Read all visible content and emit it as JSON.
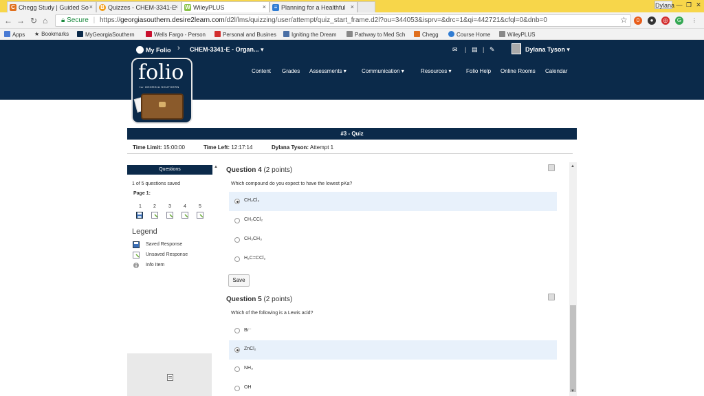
{
  "browser": {
    "tabs": [
      {
        "title": "Chegg Study | Guided So",
        "icon": "chegg-icon",
        "color": "#e0701e",
        "glyph": "C"
      },
      {
        "title": "Quizzes - CHEM-3341-E",
        "icon": "d2l-icon",
        "color": "#f39c12",
        "glyph": "B"
      },
      {
        "title": "WileyPLUS",
        "icon": "wileyplus-icon",
        "color": "#8bc34a",
        "glyph": "W"
      },
      {
        "title": "Planning for a Healthful",
        "icon": "document-icon",
        "color": "#2f7cd3",
        "glyph": "≡"
      }
    ],
    "window_user": "Dylana",
    "url_secure": "Secure",
    "url_scheme": "https://",
    "url_host": "georgiasouthern.desire2learn.com",
    "url_path": "/d2l/lms/quizzing/user/attempt/quiz_start_frame.d2l?ou=344053&isprv=&drc=1&qi=442721&cfql=0&dnb=0"
  },
  "bookmarks": [
    {
      "label": "Apps",
      "icon": "apps-icon",
      "color": "#4a7bd4"
    },
    {
      "label": "Bookmarks",
      "icon": "star-icon",
      "color": "#555555"
    },
    {
      "label": "MyGeorgiaSouthern",
      "icon": "georgia-southern-icon",
      "color": "#0b2a4a"
    },
    {
      "label": "Wells Fargo - Person",
      "icon": "wells-fargo-icon",
      "color": "#c8102e"
    },
    {
      "label": "Personal and Busines",
      "icon": "s-icon",
      "color": "#d32f2f"
    },
    {
      "label": "Igniting the Dream",
      "icon": "page-icon",
      "color": "#4a6fa5"
    },
    {
      "label": "Pathway to Med Sch",
      "icon": "page-icon",
      "color": "#888888"
    },
    {
      "label": "Chegg",
      "icon": "chegg-icon",
      "color": "#e0701e"
    },
    {
      "label": "Course Home",
      "icon": "p-icon",
      "color": "#2f7cd3"
    },
    {
      "label": "WileyPLUS",
      "icon": "page-icon",
      "color": "#888888"
    }
  ],
  "header": {
    "my_folio": "My Folio",
    "course": "CHEM-3341-E - Organ...",
    "user": "Dylana Tyson",
    "logo_word": "folio",
    "logo_sub": "for GEORGIA SOUTHERN",
    "nav": [
      "Content",
      "Grades",
      "Assessments ▾",
      "Communication ▾",
      "Resources ▾",
      "Folio Help",
      "Online Rooms",
      "Calendar"
    ]
  },
  "quiz": {
    "title": "#3 - Quiz",
    "time_limit_label": "Time Limit:",
    "time_limit": "15:00:00",
    "time_left_label": "Time Left:",
    "time_left": "12:17:14",
    "attempt_user": "Dylana Tyson:",
    "attempt": "Attempt 1"
  },
  "sidebar": {
    "heading": "Questions",
    "saved_count": "1 of 5 questions saved",
    "page": "Page 1:",
    "question_numbers": [
      "1",
      "2",
      "3",
      "4",
      "5"
    ],
    "legend_title": "Legend",
    "legend": [
      {
        "label": "Saved Response",
        "icon": "saved-response-icon"
      },
      {
        "label": "Unsaved Response",
        "icon": "unsaved-response-icon"
      },
      {
        "label": "Info Item",
        "icon": "info-icon"
      }
    ]
  },
  "questions": [
    {
      "title": "Question 4",
      "points": "(2 points)",
      "prompt": "Which compound do you expect to have the lowest pKa?",
      "options": [
        "CH₂Cl₂",
        "CH₂CCl₂",
        "CH₃CH₃",
        "H₂C=CCl₂"
      ],
      "selected": 0,
      "save_label": "Save"
    },
    {
      "title": "Question 5",
      "points": "(2 points)",
      "prompt": "Which of the following is a Lewis acid?",
      "options": [
        "Br⁻",
        "ZnCl₂",
        "NH₃",
        "OH"
      ],
      "selected": 1
    }
  ]
}
